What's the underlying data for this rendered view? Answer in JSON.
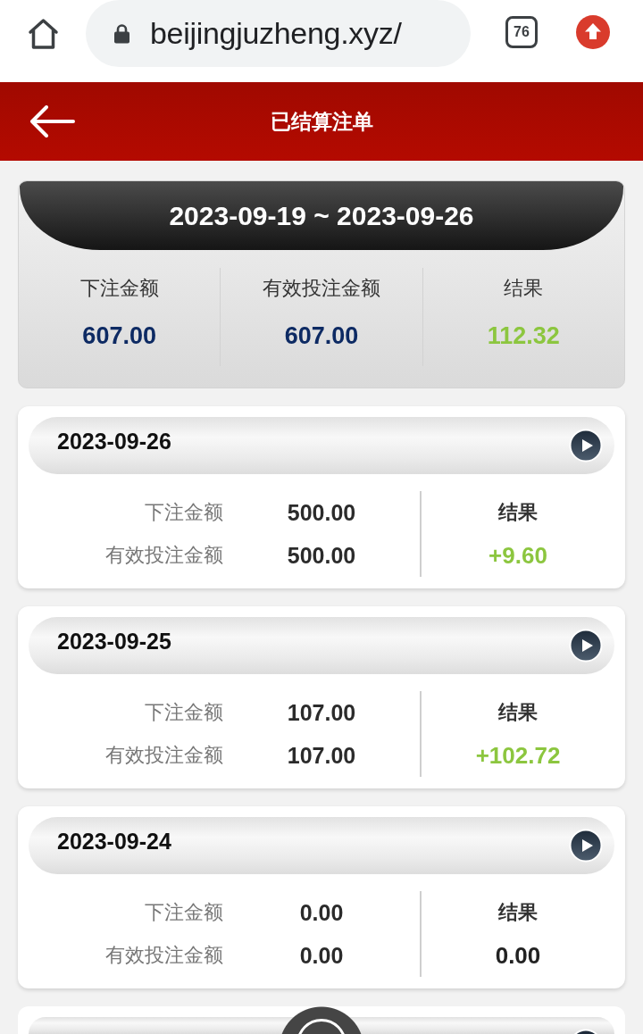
{
  "browser_bar": {
    "url": "beijingjuzheng.xyz/",
    "tab_count": "76"
  },
  "header": {
    "title": "已结算注单"
  },
  "summary": {
    "date_range": "2023-09-19 ~ 2023-09-26",
    "columns": [
      {
        "label": "下注金额",
        "value": "607.00",
        "color": "#0d2a63"
      },
      {
        "label": "有效投注金额",
        "value": "607.00",
        "color": "#0d2a63"
      },
      {
        "label": "结果",
        "value": "112.32",
        "color": "#8cc63f"
      }
    ]
  },
  "days": [
    {
      "date": "2023-09-26",
      "rows": [
        {
          "label": "下注金额",
          "value": "500.00"
        },
        {
          "label": "有效投注金额",
          "value": "500.00"
        }
      ],
      "result_label": "结果",
      "result": "+9.60",
      "color": "#8cc63f"
    },
    {
      "date": "2023-09-25",
      "rows": [
        {
          "label": "下注金额",
          "value": "107.00"
        },
        {
          "label": "有效投注金额",
          "value": "107.00"
        }
      ],
      "result_label": "结果",
      "result": "+102.72",
      "color": "#8cc63f"
    },
    {
      "date": "2023-09-24",
      "rows": [
        {
          "label": "下注金额",
          "value": "0.00"
        },
        {
          "label": "有效投注金额",
          "value": "0.00"
        }
      ],
      "result_label": "结果",
      "result": "0.00",
      "color": "#222222"
    }
  ],
  "more_below": true,
  "floating_button": true
}
